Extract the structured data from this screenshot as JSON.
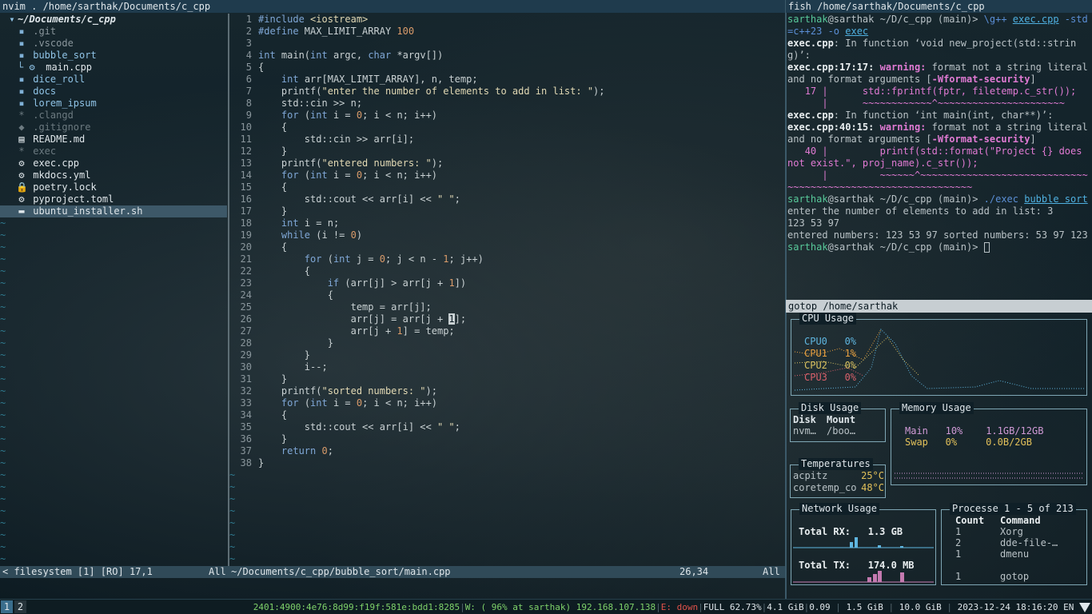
{
  "nvim": {
    "title": "nvim . /home/sarthak/Documents/c_cpp",
    "tree": {
      "root": "~/Documents/c_cpp",
      "items": [
        {
          "icon": "folder",
          "label": ".git",
          "color": "#8a969c",
          "indent": 1
        },
        {
          "icon": "folder",
          "label": ".vscode",
          "color": "#8a969c",
          "indent": 1
        },
        {
          "icon": "folder",
          "label": "bubble_sort",
          "color": "#8fc3e6",
          "indent": 1
        },
        {
          "icon": "cpp",
          "label": "main.cpp",
          "color": "#dfe6ea",
          "indent": 2
        },
        {
          "icon": "folder",
          "label": "dice_roll",
          "color": "#8fc3e6",
          "indent": 1
        },
        {
          "icon": "folder",
          "label": "docs",
          "color": "#8fc3e6",
          "indent": 1
        },
        {
          "icon": "folder",
          "label": "lorem_ipsum",
          "color": "#8fc3e6",
          "indent": 1
        },
        {
          "icon": "star",
          "label": ".clangd",
          "color": "#6c7a80",
          "indent": 1
        },
        {
          "icon": "git",
          "label": ".gitignore",
          "color": "#6c7a80",
          "indent": 1
        },
        {
          "icon": "md",
          "label": "README.md",
          "color": "#dfe6ea",
          "indent": 1
        },
        {
          "icon": "star",
          "label": "exec",
          "color": "#6c7a80",
          "indent": 1
        },
        {
          "icon": "cpp",
          "label": "exec.cpp",
          "color": "#dfe6ea",
          "indent": 1
        },
        {
          "icon": "gear",
          "label": "mkdocs.yml",
          "color": "#dfe6ea",
          "indent": 1
        },
        {
          "icon": "lock",
          "label": "poetry.lock",
          "color": "#dfe6ea",
          "indent": 1
        },
        {
          "icon": "gear",
          "label": "pyproject.toml",
          "color": "#dfe6ea",
          "indent": 1
        },
        {
          "icon": "sh",
          "label": "ubuntu_installer.sh",
          "color": "#dfe6ea",
          "indent": 1
        }
      ]
    },
    "code_lines": [
      "#include <iostream>",
      "#define MAX_LIMIT_ARRAY 100",
      "",
      "int main(int argc, char *argv[])",
      "{",
      "    int arr[MAX_LIMIT_ARRAY], n, temp;",
      "    printf(\"enter the number of elements to add in list: \");",
      "    std::cin >> n;",
      "    for (int i = 0; i < n; i++)",
      "    {",
      "        std::cin >> arr[i];",
      "    }",
      "    printf(\"entered numbers: \");",
      "    for (int i = 0; i < n; i++)",
      "    {",
      "        std::cout << arr[i] << \" \";",
      "    }",
      "    int i = n;",
      "    while (i != 0)",
      "    {",
      "        for (int j = 0; j < n - 1; j++)",
      "        {",
      "            if (arr[j] > arr[j + 1])",
      "            {",
      "                temp = arr[j];",
      "                arr[j] = arr[j + 1];",
      "                arr[j + 1] = temp;",
      "            }",
      "        }",
      "        i--;",
      "    }",
      "    printf(\"sorted numbers: \");",
      "    for (int i = 0; i < n; i++)",
      "    {",
      "        std::cout << arr[i] << \" \";",
      "    }",
      "    return 0;",
      "}"
    ],
    "status": {
      "left": "< filesystem [1] [RO] 17,1",
      "left_all": "All",
      "file": "~/Documents/c_cpp/bubble_sort/main.cpp",
      "pos": "26,34",
      "right_all": "All"
    }
  },
  "fish": {
    "title": "fish /home/sarthak/Documents/c_cpp",
    "user": "sarthak",
    "host_path": "@sarthak ~/D/c_cpp (main)>",
    "cmd1_a": "\\g++ ",
    "cmd1_arg1": "exec.cpp",
    "cmd1_b": " -std=c++23 -o ",
    "cmd1_arg2": "exec",
    "l1_file": "exec.cpp",
    "l1_rest": ": In function ‘void new_project(std::string)’:",
    "l2_loc": "exec.cpp:17:17:",
    "l2_warn": " warning:",
    "l2_rest": " format not a string literal and no format arguments [",
    "l2_flag": "-Wformat-security",
    "l2_end": "]",
    "l3": "   17 |      std::fprintf(fptr, filetemp.c_str());",
    "l4": "      |      ~~~~~~~~~~~~^~~~~~~~~~~~~~~~~~~~~~~",
    "l5_file": "exec.cpp",
    "l5_rest": ": In function ‘int main(int, char**)’:",
    "l6_loc": "exec.cpp:40:15:",
    "l6_warn": " warning:",
    "l6_rest": " format not a string literal and no format arguments [",
    "l6_flag": "-Wformat-security",
    "l6_end": "]",
    "l7": "   40 |         printf(std::format(\"Project {} does not exist.\", proj_name).c_str());",
    "l8": "      |         ~~~~~~^~~~~~~~~~~~~~~~~~~~~~~~~~~~~~~~~~~~~~~~~~~~~~~~~~~~~~~~~~~~~~",
    "cmd2_a": "./exec ",
    "cmd2_arg": "bubble sort",
    "out1": "enter the number of elements to add in list: 3",
    "out2": "123 53 97",
    "out3": "entered numbers: 123 53 97 sorted numbers: 53 97 123 ↵"
  },
  "gotop": {
    "title": "gotop /home/sarthak",
    "cpu": {
      "title": "CPU Usage",
      "cores": [
        {
          "label": "CPU0",
          "value": "0%",
          "color": "#5fb6e0"
        },
        {
          "label": "CPU1",
          "value": "1%",
          "color": "#e8a040"
        },
        {
          "label": "CPU2",
          "value": "0%",
          "color": "#d8c060"
        },
        {
          "label": "CPU3",
          "value": "0%",
          "color": "#d8606a"
        }
      ]
    },
    "disk": {
      "title": "Disk Usage",
      "col1": "Disk",
      "col2": "Mount",
      "row_disk": "nvm…",
      "row_mount": "/boo…"
    },
    "memory": {
      "title": "Memory Usage",
      "main_label": "Main",
      "main_pct": "10%",
      "main_val": "1.1GB/12GB",
      "swap_label": "Swap",
      "swap_pct": "0%",
      "swap_val": "0.0B/2GB"
    },
    "temps": {
      "title": "Temperatures",
      "rows": [
        {
          "name": "acpitz",
          "value": "25°C"
        },
        {
          "name": "coretemp_co",
          "value": "48°C"
        }
      ]
    },
    "network": {
      "title": "Network Usage",
      "rx_label": "Total RX:",
      "rx_value": "1.3 GB",
      "tx_label": "Total TX:",
      "tx_value": "174.0 MB"
    },
    "processes": {
      "title": "Processe 1 - 5 of 213",
      "col_count": "Count",
      "col_command": "Command",
      "rows": [
        {
          "count": "1",
          "command": "Xorg"
        },
        {
          "count": "2",
          "command": "dde-file-…"
        },
        {
          "count": "1",
          "command": "dmenu"
        },
        {
          "count": "",
          "command": ""
        },
        {
          "count": "1",
          "command": "gotop"
        }
      ]
    }
  },
  "bar": {
    "ws1": "1",
    "ws2": "2",
    "ipv6": "2401:4900:4e76:8d99:f19f:581e:bdd1:8285",
    "wifi": "W: ( 96% at sarthak) 192.168.107.138",
    "eth": "E: down",
    "battery": "FULL 62.73%",
    "mem": "4.1 GiB",
    "load": "0.09",
    "swap": "1.5 GiB",
    "disk": "10.0 GiB",
    "clock": "2023-12-24 18:16:20",
    "lang": "EN"
  }
}
